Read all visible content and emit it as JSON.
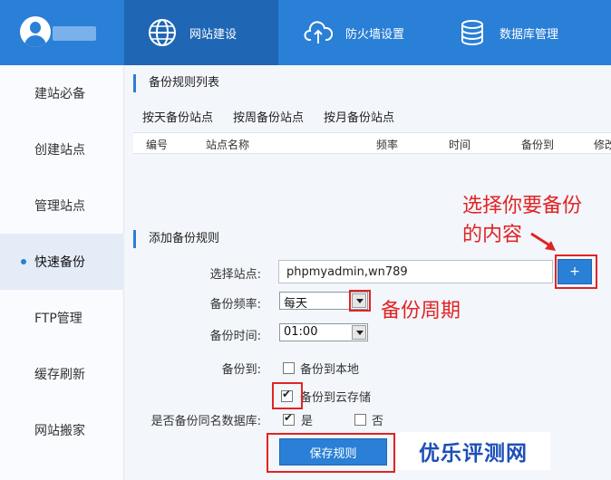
{
  "nav": {
    "tabs": [
      {
        "label": "网站建设",
        "icon": "globe-icon",
        "active": true
      },
      {
        "label": "防火墙设置",
        "icon": "cloud-upload-icon",
        "active": false
      },
      {
        "label": "数据库管理",
        "icon": "database-icon",
        "active": false
      }
    ]
  },
  "sidebar": {
    "items": [
      {
        "label": "建站必备"
      },
      {
        "label": "创建站点"
      },
      {
        "label": "管理站点"
      },
      {
        "label": "快速备份",
        "active": true
      },
      {
        "label": "FTP管理"
      },
      {
        "label": "缓存刷新"
      },
      {
        "label": "网站搬家"
      }
    ]
  },
  "backup_list": {
    "title": "备份规则列表",
    "subtabs": [
      "按天备份站点",
      "按周备份站点",
      "按月备份站点"
    ],
    "columns": [
      "编号",
      "站点名称",
      "频率",
      "时间",
      "备份到",
      "修改"
    ]
  },
  "add_rule": {
    "title": "添加备份规则",
    "site_label": "选择站点:",
    "site_value": "phpmyadmin,wn789",
    "add_button": "+",
    "frequency_label": "备份频率:",
    "frequency_value": "每天",
    "time_label": "备份时间:",
    "time_value": "01:00",
    "backup_to_label": "备份到:",
    "local_option": "备份到本地",
    "local_checked": false,
    "cloud_option": "备份到云存储",
    "cloud_checked": true,
    "same_db_label": "是否备份同名数据库:",
    "yes_option": "是",
    "yes_checked": true,
    "no_option": "否",
    "no_checked": false,
    "save_button": "保存规则"
  },
  "annotations": {
    "choose_line1": "选择你要备份",
    "choose_line2": "的内容",
    "period": "备份周期",
    "watermark": "优乐评测网"
  },
  "colors": {
    "accent": "#2a7fd6",
    "annotation": "#e02424",
    "watermark": "#1d4fb8"
  }
}
